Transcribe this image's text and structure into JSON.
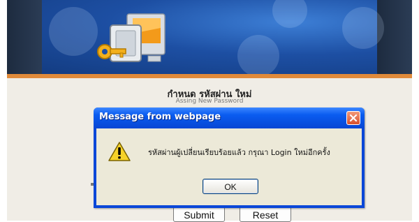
{
  "page": {
    "title_thai": "กำหนด รหัสผ่าน ใหม่",
    "title_english": "Assing New Password",
    "submit_label": "Submit",
    "reset_label": "Reset"
  },
  "dialog": {
    "title": "Message from webpage",
    "message": "รหัสผ่านผู้เปลี่ยนเรียบร้อยแล้ว กรุณา Login ใหม่อีกครั้ง",
    "ok_label": "OK",
    "icon": "warning-icon",
    "close_icon": "close-icon"
  },
  "colors": {
    "banner_blue": "#1d4fa3",
    "banner_stripe": "#e08a3a",
    "panel_bg": "#f0ede6",
    "dialog_title_blue": "#0746d4",
    "dialog_body": "#ece9d8",
    "close_red": "#d9502c"
  }
}
